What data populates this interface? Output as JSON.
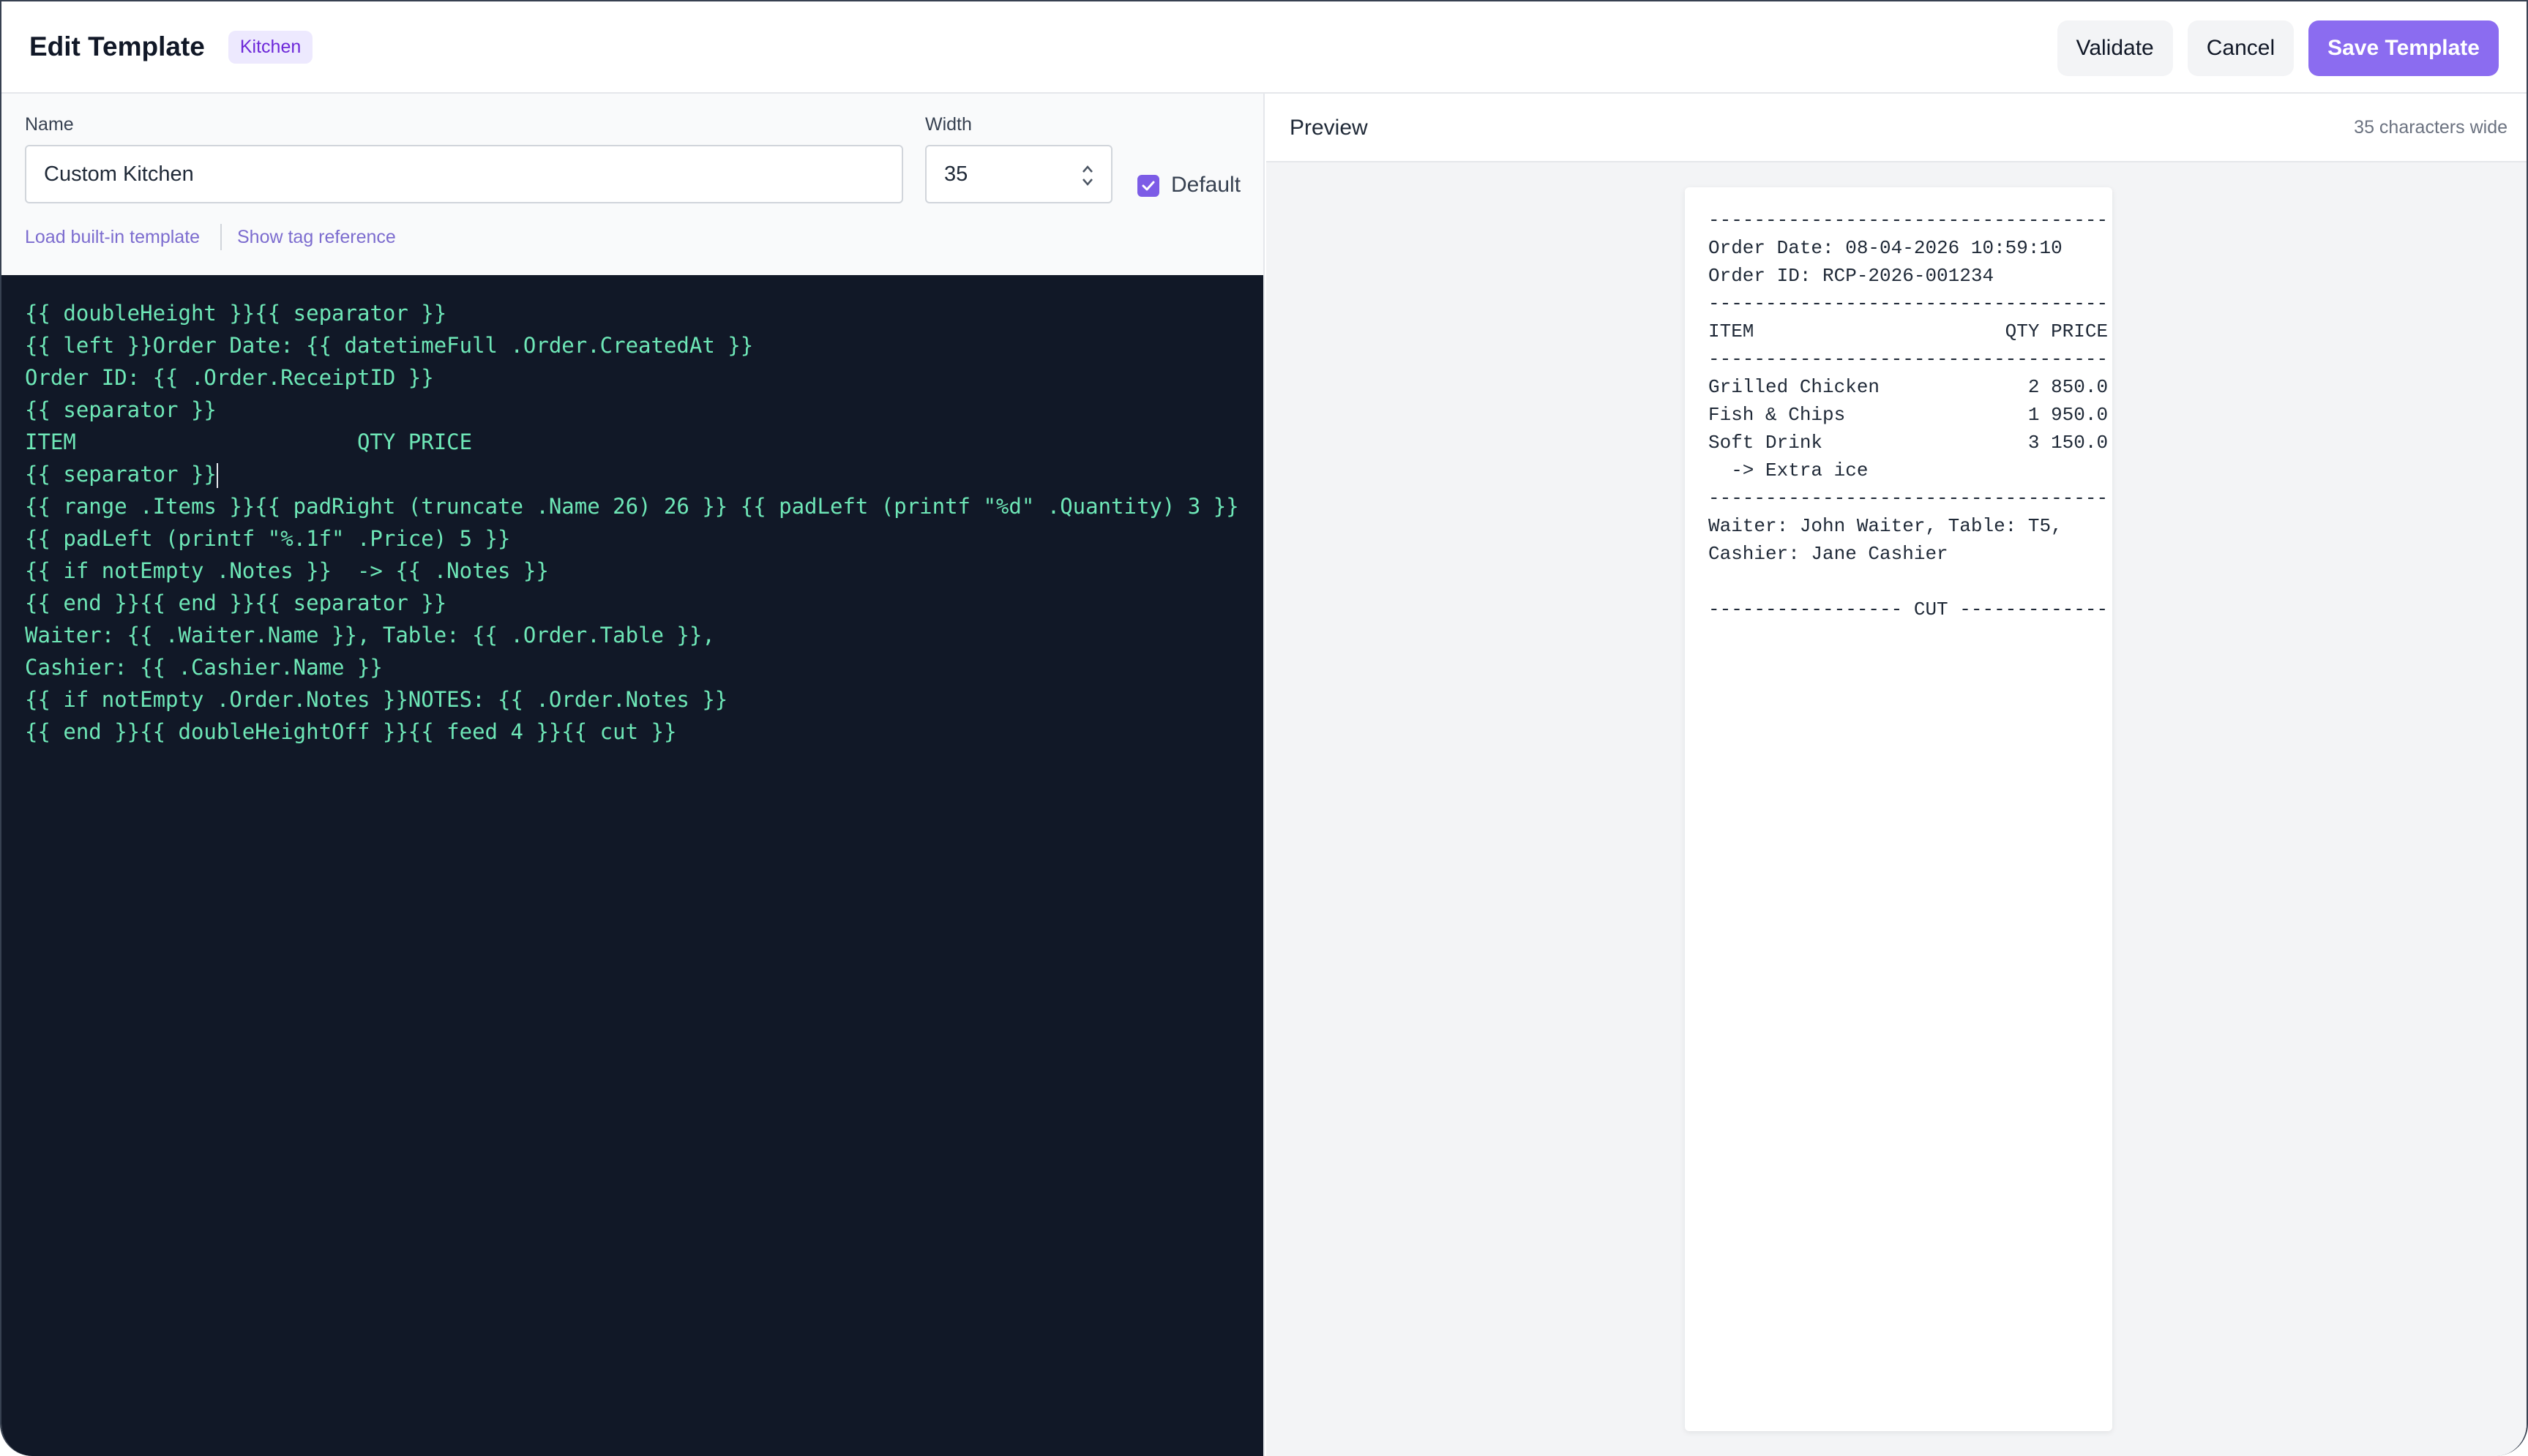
{
  "header": {
    "title": "Edit Template",
    "badge": "Kitchen",
    "validate_label": "Validate",
    "cancel_label": "Cancel",
    "save_label": "Save Template"
  },
  "form": {
    "name_label": "Name",
    "name_value": "Custom Kitchen",
    "width_label": "Width",
    "width_value": "35",
    "default_label": "Default",
    "default_checked": true,
    "load_builtin_label": "Load built-in template",
    "show_tags_label": "Show tag reference"
  },
  "editor": {
    "lines": [
      "{{ doubleHeight }}{{ separator }}",
      "{{ left }}Order Date: {{ datetimeFull .Order.CreatedAt }}",
      "Order ID: {{ .Order.ReceiptID }}",
      "{{ separator }}",
      "ITEM                      QTY PRICE",
      "{{ separator }}",
      "{{ range .Items }}{{ padRight (truncate .Name 26) 26 }} {{ padLeft (printf \"%d\" .Quantity) 3 }}",
      "{{ padLeft (printf \"%.1f\" .Price) 5 }}",
      "{{ if notEmpty .Notes }}  -> {{ .Notes }}",
      "{{ end }}{{ end }}{{ separator }}",
      "Waiter: {{ .Waiter.Name }}, Table: {{ .Order.Table }},",
      "Cashier: {{ .Cashier.Name }}",
      "{{ if notEmpty .Order.Notes }}NOTES: {{ .Order.Notes }}",
      "{{ end }}{{ doubleHeightOff }}{{ feed 4 }}{{ cut }}"
    ]
  },
  "preview": {
    "title": "Preview",
    "chars_wide": "35 characters wide",
    "receipt_lines": [
      "-----------------------------------",
      "Order Date: 08-04-2026 10:59:10",
      "Order ID: RCP-2026-001234",
      "-----------------------------------",
      "ITEM                      QTY PRICE",
      "-----------------------------------",
      "Grilled Chicken             2 850.0",
      "Fish & Chips                1 950.0",
      "Soft Drink                  3 150.0",
      "  -> Extra ice",
      "-----------------------------------",
      "Waiter: John Waiter, Table: T5,",
      "Cashier: Jane Cashier",
      "",
      "----------------- CUT -------------"
    ]
  },
  "colors": {
    "accent": "#8b6cf0",
    "editor_bg": "#111827",
    "editor_text": "#6ee7b7"
  }
}
